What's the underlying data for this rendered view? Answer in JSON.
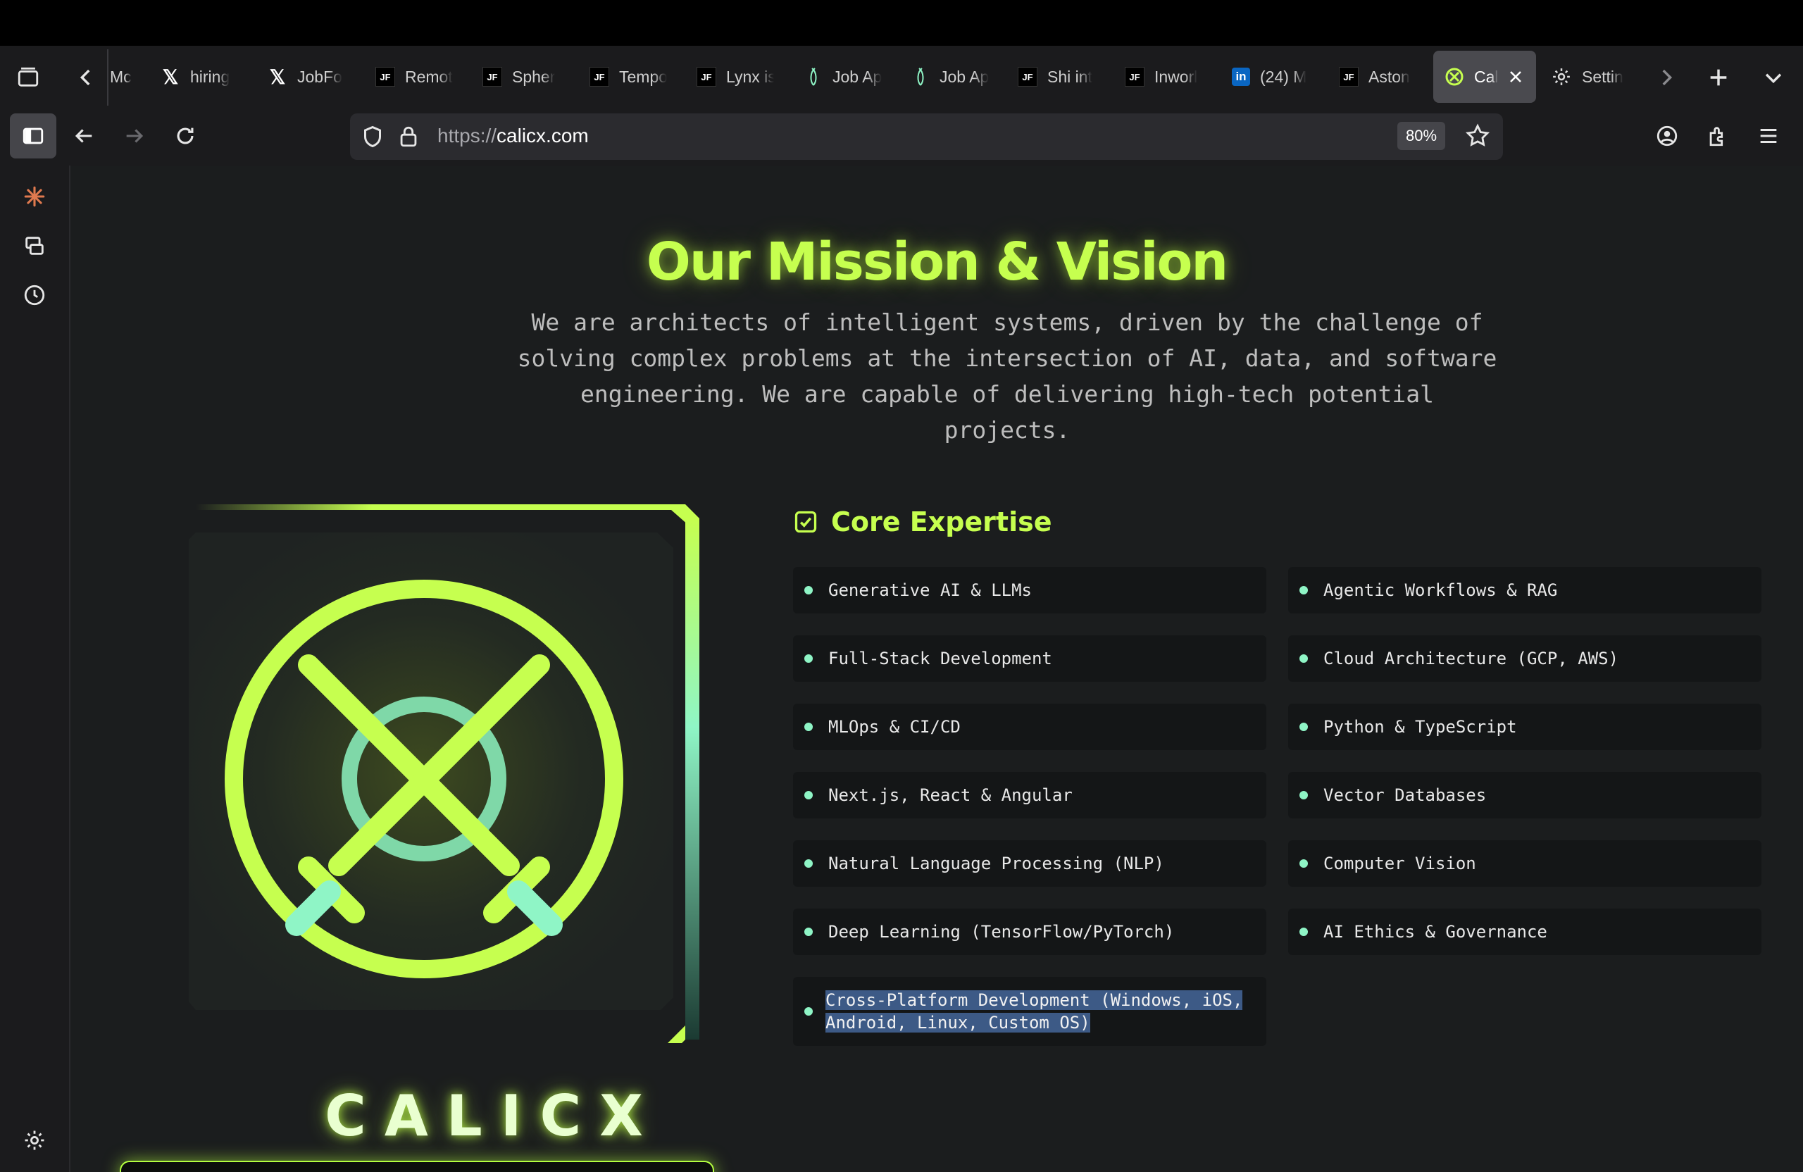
{
  "browser": {
    "tabs": [
      {
        "title": "Mc",
        "icon": "arrow-icon"
      },
      {
        "title": "hiring",
        "icon": "x-icon"
      },
      {
        "title": "JobFo",
        "icon": "x-icon"
      },
      {
        "title": "Remot",
        "icon": "jf-icon"
      },
      {
        "title": "Spher",
        "icon": "jf-icon"
      },
      {
        "title": "Tempo",
        "icon": "jf-icon"
      },
      {
        "title": "Lynx is",
        "icon": "jf-icon"
      },
      {
        "title": "Job Ap",
        "icon": "job-icon"
      },
      {
        "title": "Job Ap",
        "icon": "job-icon"
      },
      {
        "title": "Shi int",
        "icon": "jf-icon"
      },
      {
        "title": "Inworl",
        "icon": "jf-icon"
      },
      {
        "title": "(24) M",
        "icon": "linkedin-icon"
      },
      {
        "title": "Aston",
        "icon": "jf-icon"
      },
      {
        "title": "Cal",
        "icon": "calicx-icon",
        "active": true
      },
      {
        "title": "Settin",
        "icon": "gear-icon"
      }
    ],
    "favicon_jf": "JF",
    "favicon_li": "in",
    "url_scheme": "https://",
    "url_host": "calicx.com",
    "zoom": "80%",
    "colors": {
      "chrome_bg": "#1b1b1d",
      "urlbar_bg": "#2b2b2f",
      "active_tab": "#4a4a4f"
    }
  },
  "page": {
    "mission_title": "Our Mission & Vision",
    "mission_text": "We are architects of intelligent systems, driven by the challenge of solving complex problems at the intersection of AI, data, and software engineering. We are capable of delivering high-tech potential projects.",
    "core_title": "Core Expertise",
    "logo_text": "CALICX",
    "expertise": [
      "Generative AI & LLMs",
      "Agentic Workflows & RAG",
      "Full-Stack Development",
      "Cloud Architecture (GCP, AWS)",
      "MLOps & CI/CD",
      "Python & TypeScript",
      "Next.js, React & Angular",
      "Vector Databases",
      "Natural Language Processing (NLP)",
      "Computer Vision",
      "Deep Learning (TensorFlow/PyTorch)",
      "AI Ethics & Governance"
    ],
    "selected_expertise_line1": "Cross-Platform Development (Windows, iOS,",
    "selected_expertise_line2": "Android, Linux, Custom OS)",
    "colors": {
      "accent": "#c6ff4f",
      "mint": "#8ff5c6",
      "card_bg": "#141617",
      "page_bg": "#1b1d1e"
    }
  }
}
